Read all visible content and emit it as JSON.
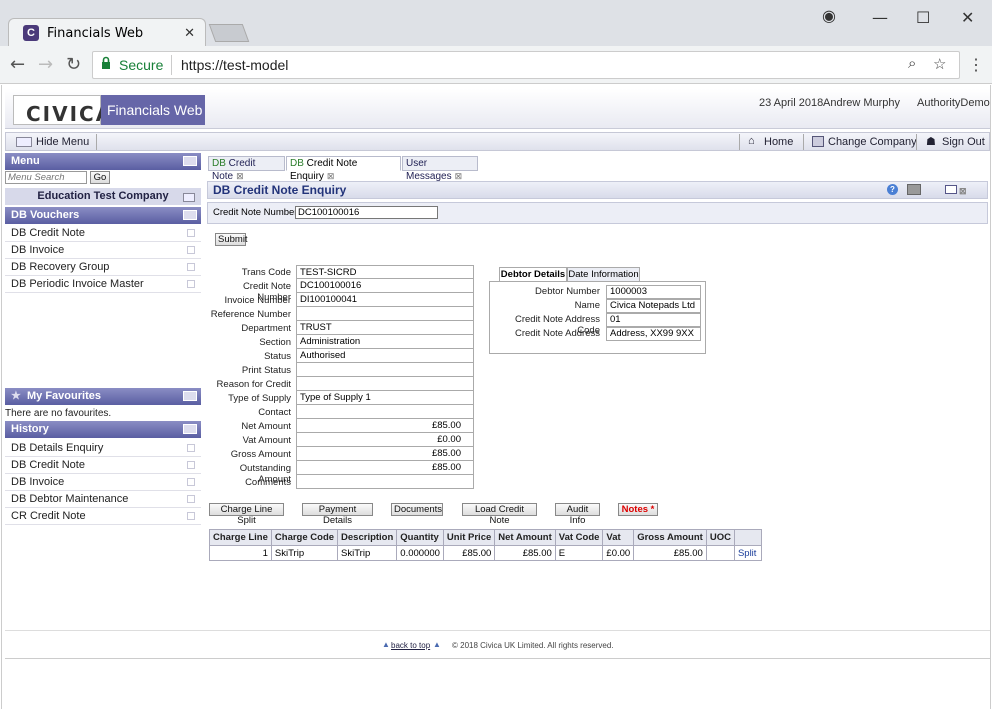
{
  "browser": {
    "tab_title": "Financials Web",
    "favicon_letter": "C",
    "secure_label": "Secure",
    "url": "https://test-model"
  },
  "header": {
    "logo": "CIVICA",
    "app_name": "Financials Web",
    "date": "23 April 2018",
    "user": "Andrew Murphy",
    "authority": "AuthorityDemo"
  },
  "toolbar": {
    "hide_menu": "Hide Menu",
    "home": "Home",
    "change_company": "Change Company",
    "sign_out": "Sign Out"
  },
  "sidebar": {
    "menu_title": "Menu",
    "search_placeholder": "Menu Search",
    "go_label": "Go",
    "company": "Education Test Company",
    "vouchers_title": "DB Vouchers",
    "vouchers": [
      "DB Credit Note",
      "DB Invoice",
      "DB Recovery Group",
      "DB Periodic Invoice Master"
    ],
    "favourites_title": "My Favourites",
    "favourites_empty": "There are no favourites.",
    "history_title": "History",
    "history": [
      "DB Details Enquiry",
      "DB Credit Note",
      "DB Invoice",
      "DB Debtor Maintenance",
      "CR Credit Note"
    ]
  },
  "tabs": [
    {
      "prefix": "DB",
      "label": " Credit Note"
    },
    {
      "prefix": "DB",
      "label": " Credit Note Enquiry"
    },
    {
      "prefix": "",
      "label": "User Messages"
    }
  ],
  "enquiry": {
    "title": "DB Credit Note Enquiry",
    "search_label": "Credit Note Number",
    "search_value": "DC100100016",
    "submit": "Submit"
  },
  "fields": [
    {
      "label": "Trans Code",
      "value": "TEST-SICRD"
    },
    {
      "label": "Credit Note Number",
      "value": "DC100100016"
    },
    {
      "label": "Invoice Number",
      "value": "DI100100041"
    },
    {
      "label": "Reference Number",
      "value": ""
    },
    {
      "label": "Department",
      "value": "TRUST"
    },
    {
      "label": "Section",
      "value": "Administration"
    },
    {
      "label": "Status",
      "value": "Authorised"
    },
    {
      "label": "Print Status",
      "value": ""
    },
    {
      "label": "Reason for Credit",
      "value": ""
    },
    {
      "label": "Type of Supply",
      "value": "Type of Supply 1"
    },
    {
      "label": "Contact",
      "value": ""
    },
    {
      "label": "Net Amount",
      "value": "£85.00"
    },
    {
      "label": "Vat Amount",
      "value": "£0.00"
    },
    {
      "label": "Gross Amount",
      "value": "£85.00"
    },
    {
      "label": "Outstanding Amount",
      "value": "£85.00"
    },
    {
      "label": "Comments",
      "value": ""
    }
  ],
  "debtor": {
    "tabs": [
      "Debtor Details",
      "Date Information"
    ],
    "rows": [
      {
        "label": "Debtor Number",
        "value": "1000003"
      },
      {
        "label": "Name",
        "value": "Civica Notepads Ltd"
      },
      {
        "label": "Credit Note Address Code",
        "value": "01"
      },
      {
        "label": "Credit Note Address",
        "value": "Address, XX99 9XX"
      }
    ]
  },
  "actions": [
    "Charge Line Split",
    "Payment Details",
    "Documents",
    "Load Credit Note",
    "Audit Info",
    "Notes *"
  ],
  "charge_table": {
    "headers": [
      "Charge Line",
      "Charge Code",
      "Description",
      "Quantity",
      "Unit Price",
      "Net Amount",
      "Vat Code",
      "Vat",
      "Gross Amount",
      "UOC",
      ""
    ],
    "rows": [
      [
        "1",
        "SkiTrip",
        "SkiTrip",
        "0.000000",
        "£85.00",
        "£85.00",
        "E",
        "£0.00",
        "£85.00",
        "",
        "Split"
      ]
    ]
  },
  "footer": {
    "back_to_top": "back to top",
    "copyright": "© 2018 Civica UK Limited. All rights reserved."
  }
}
